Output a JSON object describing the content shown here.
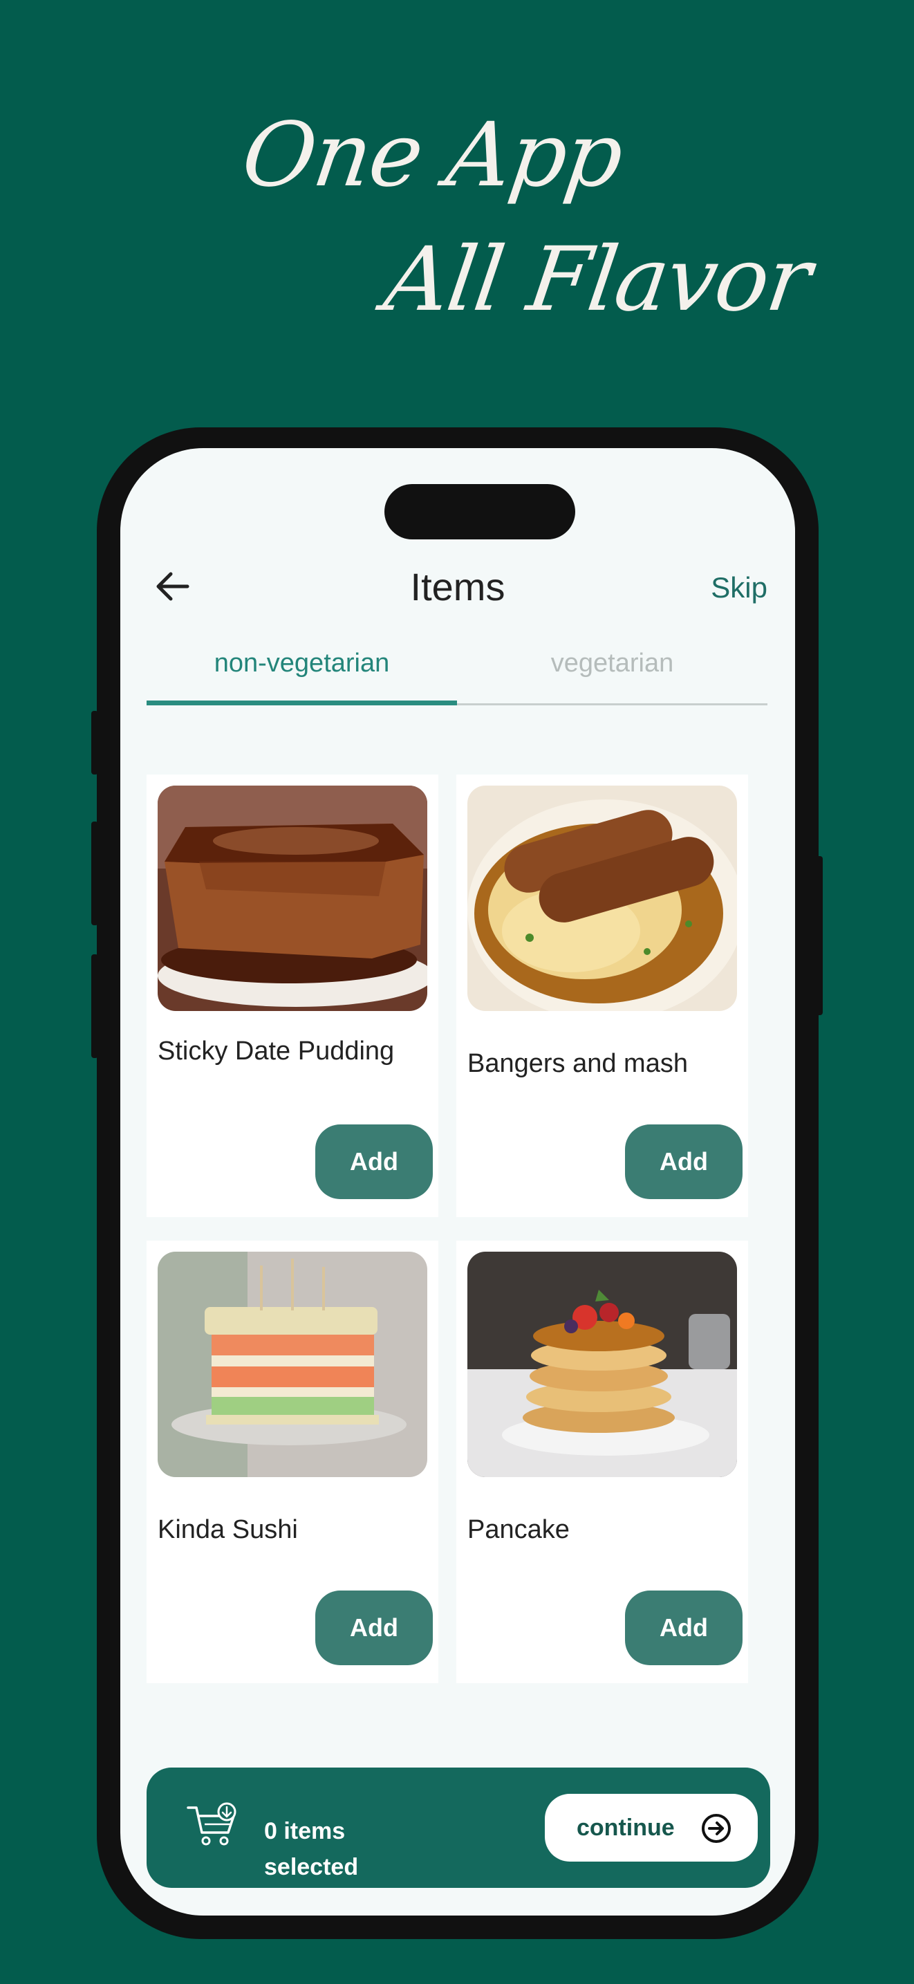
{
  "promo": {
    "line1": "One App",
    "line2": "All Flavor"
  },
  "header": {
    "title": "Items",
    "skip_label": "Skip",
    "back_icon": "arrow-left-icon"
  },
  "tabs": [
    {
      "label": "non-vegetarian",
      "active": true
    },
    {
      "label": "vegetarian",
      "active": false
    }
  ],
  "items": [
    {
      "name": "Sticky Date Pudding",
      "add_label": "Add"
    },
    {
      "name": "Bangers and mash",
      "add_label": "Add"
    },
    {
      "name": "Kinda Sushi",
      "add_label": "Add"
    },
    {
      "name": "Pancake",
      "add_label": "Add"
    }
  ],
  "cart": {
    "count_text": "0 items selected",
    "continue_label": "continue",
    "icons": [
      "cart-icon",
      "arrow-right-circle-icon"
    ]
  },
  "colors": {
    "background": "#035c4d",
    "accent": "#2a8d80",
    "button": "#3b7d73",
    "cart_bar": "#14695d"
  }
}
